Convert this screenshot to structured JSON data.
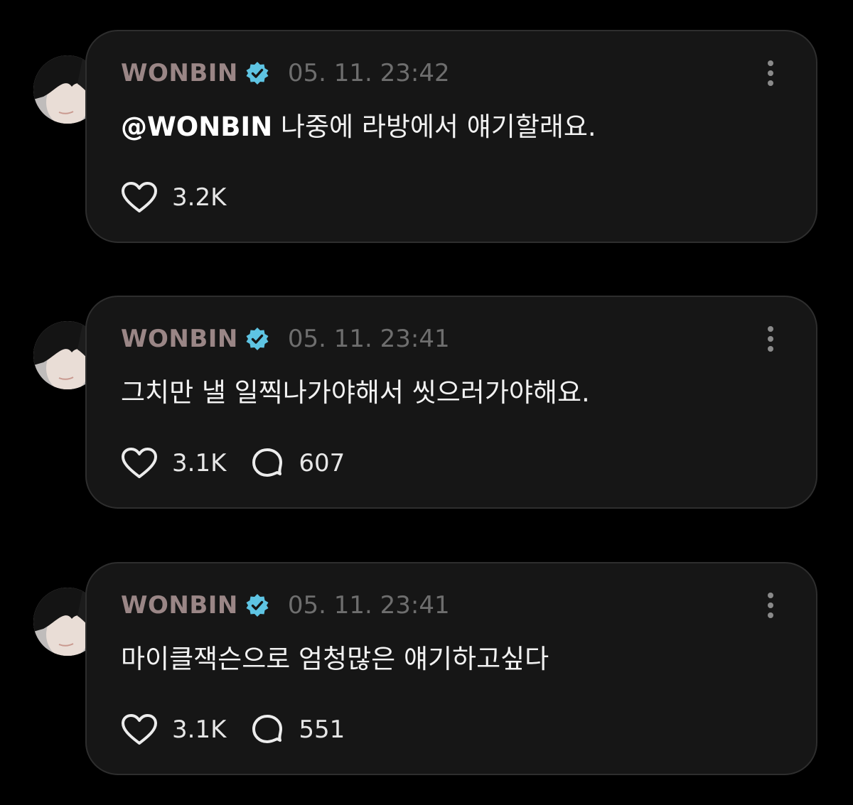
{
  "colors": {
    "background": "#000000",
    "card": "#161616",
    "card_border": "#2e2e2e",
    "username": "#9a8686",
    "verified_badge": "#5ec4e3",
    "timestamp": "#6e6e6e",
    "text": "#f2f2f2"
  },
  "posts": [
    {
      "username": "WONBIN",
      "verified_icon": "verified-badge-icon",
      "timestamp": "05. 11. 23:42",
      "mention": "@WONBIN",
      "text": " 나중에 라방에서 얘기할래요.",
      "likes": "3.2K",
      "replies": ""
    },
    {
      "username": "WONBIN",
      "verified_icon": "verified-badge-icon",
      "timestamp": "05. 11. 23:41",
      "mention": "",
      "text": "그치만 낼 일찍나가야해서 씻으러가야해요.",
      "likes": "3.1K",
      "replies": "607"
    },
    {
      "username": "WONBIN",
      "verified_icon": "verified-badge-icon",
      "timestamp": "05. 11. 23:41",
      "mention": "",
      "text": "마이클잭슨으로 엄청많은 얘기하고싶다",
      "likes": "3.1K",
      "replies": "551"
    }
  ]
}
